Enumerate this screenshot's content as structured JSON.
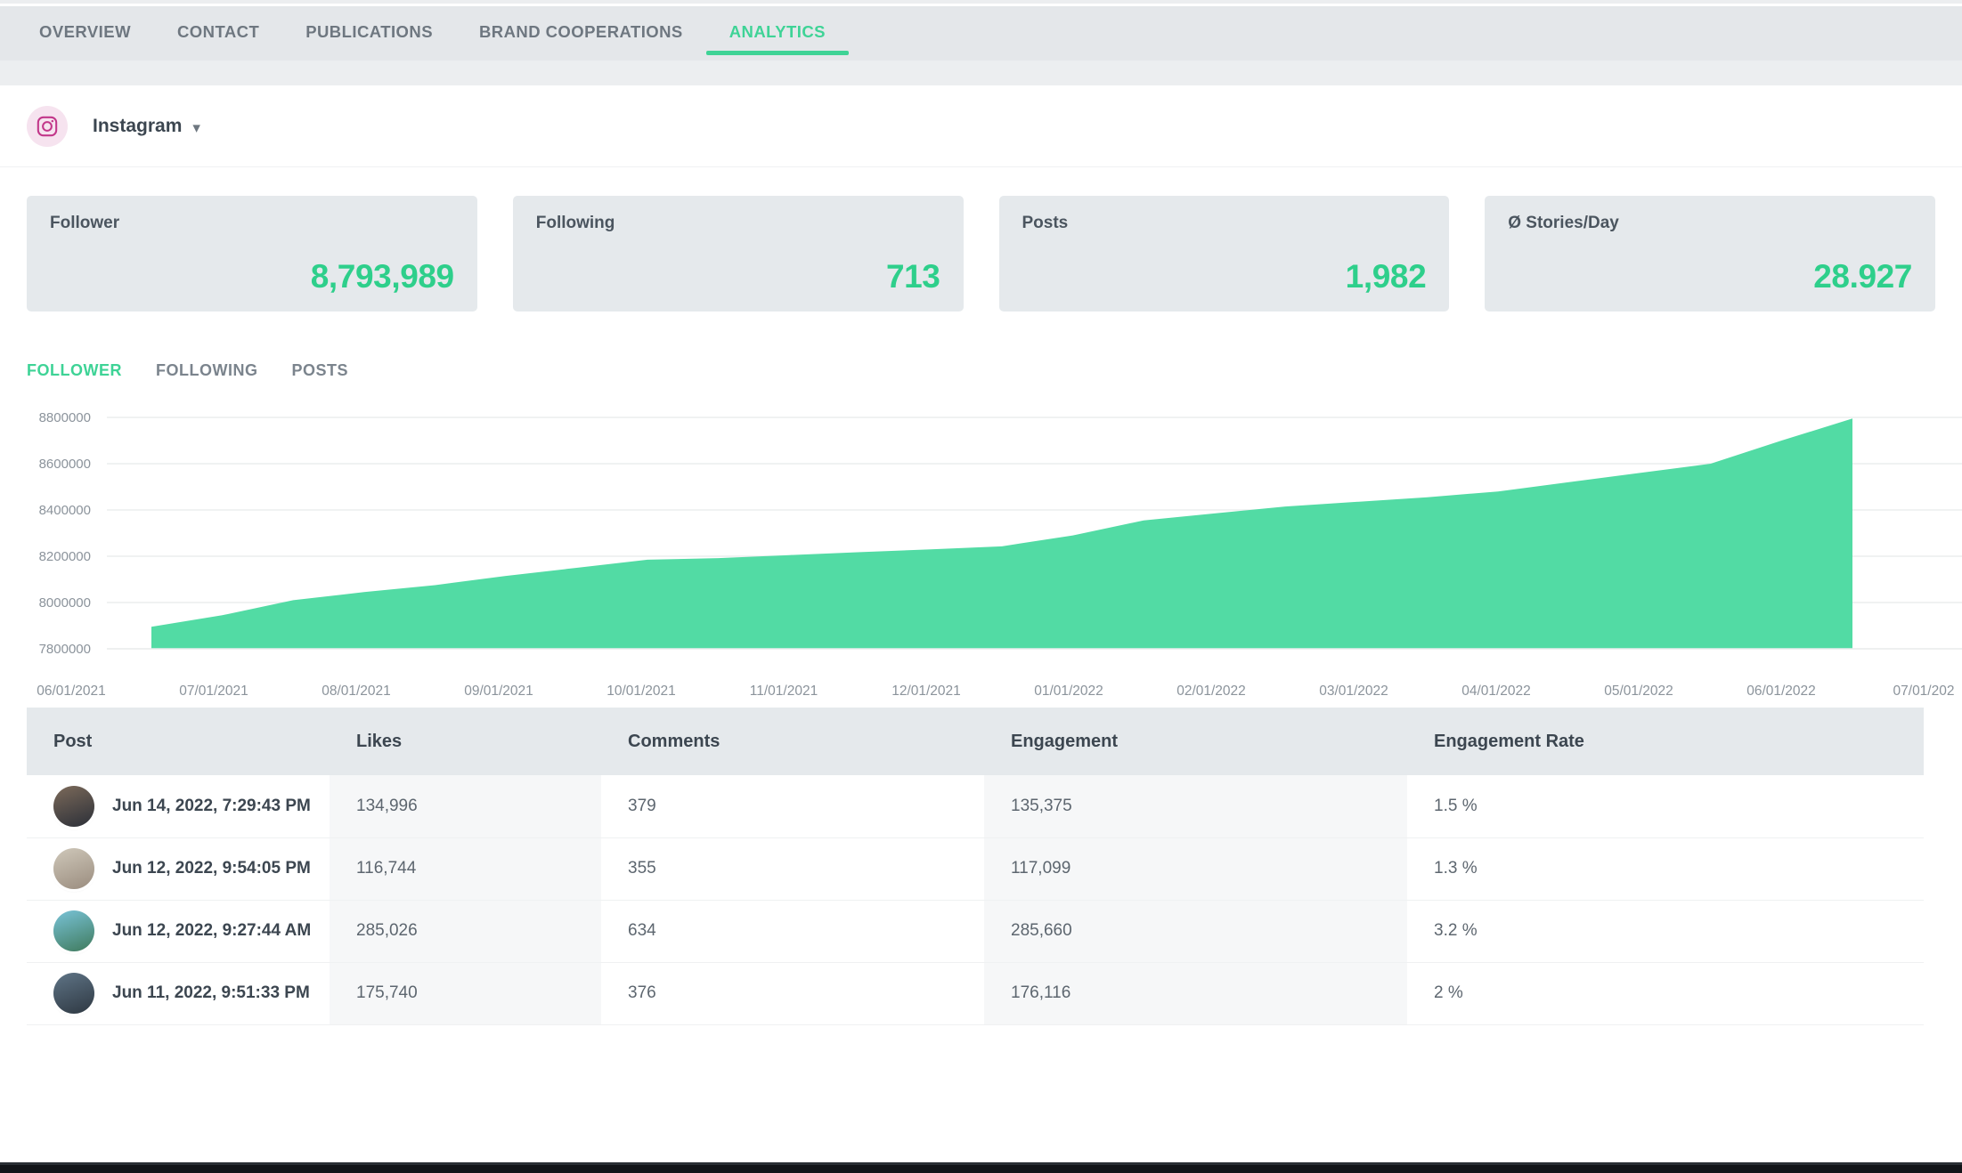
{
  "topnav": {
    "items": [
      {
        "label": "OVERVIEW",
        "active": false
      },
      {
        "label": "CONTACT",
        "active": false
      },
      {
        "label": "PUBLICATIONS",
        "active": false
      },
      {
        "label": "BRAND COOPERATIONS",
        "active": false
      },
      {
        "label": "ANALYTICS",
        "active": true
      }
    ]
  },
  "platform": {
    "name": "Instagram",
    "icon": "instagram-icon",
    "chevron": "⌄",
    "accent_pink": "#c2378a",
    "badge_bg": "#f6e3ef"
  },
  "stats": [
    {
      "label": "Follower",
      "value": "8,793,989"
    },
    {
      "label": "Following",
      "value": "713"
    },
    {
      "label": "Posts",
      "value": "1,982"
    },
    {
      "label": "Ø Stories/Day",
      "value": "28.927"
    }
  ],
  "chart_tabs": [
    {
      "label": "FOLLOWER",
      "active": true
    },
    {
      "label": "FOLLOWING",
      "active": false
    },
    {
      "label": "POSTS",
      "active": false
    }
  ],
  "colors": {
    "accent_green": "#3ed396",
    "stat_green": "#2ecf8b",
    "area_fill": "#52dba4",
    "card_bg": "#e5e9ec",
    "topbar_bg": "#e4e7ea",
    "muted_text": "#7b848d"
  },
  "chart_data": {
    "type": "area",
    "title": "",
    "xlabel": "",
    "ylabel": "",
    "series_name": "Follower",
    "grid": true,
    "legend": "none",
    "ylim": [
      7800000,
      8800000
    ],
    "yticks": [
      8800000,
      8600000,
      8400000,
      8200000,
      8000000,
      7800000
    ],
    "ytick_labels": [
      "8800000",
      "8600000",
      "8400000",
      "8200000",
      "8000000",
      "7800000"
    ],
    "xticks": [
      "06/01/2021",
      "07/01/2021",
      "08/01/2021",
      "09/01/2021",
      "10/01/2021",
      "11/01/2021",
      "12/01/2021",
      "01/01/2022",
      "02/01/2022",
      "03/01/2022",
      "04/01/2022",
      "05/01/2022",
      "06/01/2022",
      "07/01/202"
    ],
    "x": [
      "06/15/2021",
      "07/01/2021",
      "07/15/2021",
      "08/01/2021",
      "08/15/2021",
      "09/01/2021",
      "09/15/2021",
      "10/01/2021",
      "10/15/2021",
      "11/01/2021",
      "11/15/2021",
      "12/01/2021",
      "12/15/2021",
      "01/01/2022",
      "01/15/2022",
      "02/01/2022",
      "02/15/2022",
      "03/01/2022",
      "03/15/2022",
      "04/01/2022",
      "04/15/2022",
      "05/01/2022",
      "05/15/2022",
      "06/01/2022",
      "06/15/2022"
    ],
    "values": [
      7895000,
      7945000,
      8010000,
      8045000,
      8075000,
      8115000,
      8150000,
      8185000,
      8192000,
      8205000,
      8218000,
      8230000,
      8243000,
      8290000,
      8355000,
      8385000,
      8415000,
      8435000,
      8455000,
      8480000,
      8520000,
      8560000,
      8600000,
      8700000,
      8795000
    ]
  },
  "table": {
    "headers": [
      "Post",
      "Likes",
      "Comments",
      "Engagement",
      "Engagement Rate"
    ],
    "rows": [
      {
        "date": "Jun 14, 2022, 7:29:43 PM",
        "likes": "134,996",
        "comments": "379",
        "engagement": "135,375",
        "rate": "1.5 %",
        "thumb_a": "#7c6a5a",
        "thumb_b": "#2b2f38"
      },
      {
        "date": "Jun 12, 2022, 9:54:05 PM",
        "likes": "116,744",
        "comments": "355",
        "engagement": "117,099",
        "rate": "1.3 %",
        "thumb_a": "#cfc8ba",
        "thumb_b": "#9a8c7e"
      },
      {
        "date": "Jun 12, 2022, 9:27:44 AM",
        "likes": "285,026",
        "comments": "634",
        "engagement": "285,660",
        "rate": "3.2 %",
        "thumb_a": "#79c3d8",
        "thumb_b": "#3f7a5c"
      },
      {
        "date": "Jun 11, 2022, 9:51:33 PM",
        "likes": "175,740",
        "comments": "376",
        "engagement": "176,116",
        "rate": "2 %",
        "thumb_a": "#5f7486",
        "thumb_b": "#2e3842"
      }
    ]
  }
}
